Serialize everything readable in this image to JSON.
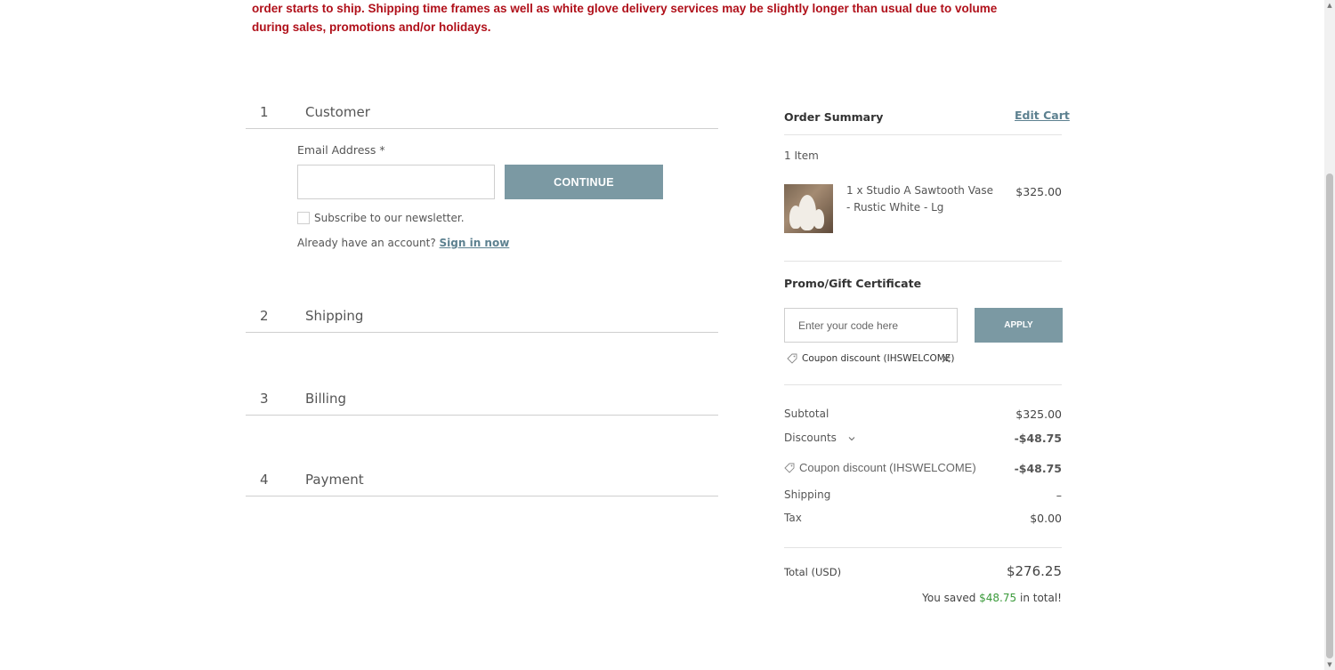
{
  "notice": {
    "text": "order starts to ship. Shipping time frames as well as white glove delivery services may be slightly longer than usual due to volume during sales, promotions and/or holidays."
  },
  "steps": [
    {
      "num": "1",
      "title": "Customer"
    },
    {
      "num": "2",
      "title": "Shipping"
    },
    {
      "num": "3",
      "title": "Billing"
    },
    {
      "num": "4",
      "title": "Payment"
    }
  ],
  "customer": {
    "email_label": "Email Address *",
    "email_value": "",
    "continue_label": "CONTINUE",
    "newsletter_label": "Subscribe to our newsletter.",
    "account_prompt": "Already have an account?",
    "sign_in_label": "Sign in now"
  },
  "summary": {
    "title": "Order Summary",
    "edit_cart_label": "Edit Cart",
    "item_count": "1 Item",
    "product_name": "1 x Studio A Sawtooth Vase - Rustic White - Lg",
    "product_price": "$325.00",
    "promo_title": "Promo/Gift Certificate",
    "promo_placeholder": "Enter your code here",
    "apply_label": "APPLY",
    "coupon_tag": "Coupon discount (IHSWELCOME)",
    "subtotal_label": "Subtotal",
    "subtotal_value": "$325.00",
    "discounts_label": "Discounts",
    "discounts_value": "-$48.75",
    "coupon_line_label": "Coupon discount (IHSWELCOME)",
    "coupon_line_value": "-$48.75",
    "shipping_label": "Shipping",
    "shipping_value": "–",
    "tax_label": "Tax",
    "tax_value": "$0.00",
    "total_label": "Total (USD)",
    "total_value": "$276.25",
    "saved_prefix": "You saved",
    "saved_amount": "$48.75",
    "saved_suffix": "in total!"
  },
  "icons": {
    "coupon": "tag-icon",
    "remove": "close-icon",
    "discounts_toggle": "chevron-down-icon"
  },
  "colors": {
    "accent": "#7b99a3",
    "link": "#5d8190",
    "notice": "#b0101a",
    "saved": "#3a9a3a"
  }
}
